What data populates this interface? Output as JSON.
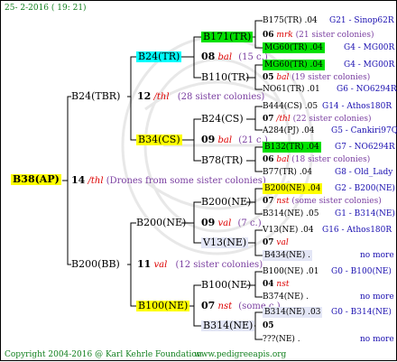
{
  "header": {
    "date": "25- 2-2016 ( 19: 21)"
  },
  "footer": {
    "copyright": "Copyright 2004-2016 @ Karl Kehrle Foundation.",
    "site": "www.pedigreeapis.org"
  },
  "colors": {
    "cyan": "#00ffff",
    "yellow": "#ffff00",
    "green": "#00e000",
    "gray": "#e3e6f6",
    "lines": "#000000"
  },
  "root": {
    "label": "B38(AP)",
    "num": "14",
    "sym": "/thl",
    "desc": "(Drones from some sister colonies)"
  },
  "gen1": [
    {
      "label": "B24(TBR)",
      "num": "12",
      "sym": "/thl",
      "desc": "(28 sister colonies)"
    },
    {
      "label": "B200(BB)",
      "num": "11",
      "sym": "val",
      "desc": "(12 sister colonies)"
    }
  ],
  "gen2": [
    {
      "label": "B24(TR)",
      "num": "08",
      "sym": "bal",
      "desc": "(15 c.)"
    },
    {
      "label": "B34(CS)",
      "num": "09",
      "sym": "bal",
      "desc": "(21 c.)"
    },
    {
      "label": "B200(NE)",
      "num": "09",
      "sym": "val",
      "desc": "(7 c.)"
    },
    {
      "label": "B100(NE)",
      "num": "07",
      "sym": "nst",
      "desc": "(some c.)"
    }
  ],
  "gen3": [
    "B171(TR)",
    "B110(TR)",
    "B24(CS)",
    "B78(TR)",
    "B200(NE)",
    "V13(NE)",
    "B100(NE)",
    "B314(NE)"
  ],
  "gen4": [
    {
      "rows": [
        {
          "text": "B175(TR) .04",
          "ref": "G21 - Sinop62R"
        },
        {
          "num": "06",
          "sym": "mrk",
          "desc": "(21 sister colonies)"
        },
        {
          "text": "MG60(TR) .04",
          "ref": "G4 - MG00R"
        }
      ]
    },
    {
      "rows": [
        {
          "text": "MG60(TR) .04",
          "ref": "G4 - MG00R"
        },
        {
          "num": "05",
          "sym": "bal",
          "desc": "(19 sister colonies)"
        },
        {
          "text": "NO61(TR) .01",
          "ref": "G6 - NO6294R"
        }
      ]
    },
    {
      "rows": [
        {
          "text": "B444(CS) .05",
          "ref": "G14 - Athos180R"
        },
        {
          "num": "07",
          "sym": "/thl",
          "desc": "(22 sister colonies)"
        },
        {
          "text": "A284(PJ) .04",
          "ref": "G5 - Cankiri97Q"
        }
      ]
    },
    {
      "rows": [
        {
          "text": "B132(TR) .04",
          "ref": "G7 - NO6294R"
        },
        {
          "num": "06",
          "sym": "bal",
          "desc": "(18 sister colonies)"
        },
        {
          "text": "B77(TR) .04",
          "ref": "G8 - Old_Lady"
        }
      ]
    },
    {
      "rows": [
        {
          "text": "B200(NE) .04",
          "ref": "G2 - B200(NE)"
        },
        {
          "num": "07",
          "sym": "nst",
          "desc": "(some sister colonies)"
        },
        {
          "text": "B314(NE) .05",
          "ref": "G1 - B314(NE)"
        }
      ]
    },
    {
      "rows": [
        {
          "text": "V13(NE) .04",
          "ref": "G16 - Athos180R"
        },
        {
          "num": "07",
          "sym": "val",
          "desc": ""
        },
        {
          "text": "B434(NE) .",
          "ref": "no more"
        }
      ]
    },
    {
      "rows": [
        {
          "text": "B100(NE) .01",
          "ref": "G0 - B100(NE)"
        },
        {
          "num": "04",
          "sym": "nst",
          "desc": ""
        },
        {
          "text": "B374(NE) .",
          "ref": "no more"
        }
      ]
    },
    {
      "rows": [
        {
          "text": "B314(NE) .03",
          "ref": "G0 - B314(NE)"
        },
        {
          "num": "05",
          "sym": "",
          "desc": ""
        },
        {
          "text": "???(NE) .",
          "ref": "no more"
        }
      ]
    }
  ]
}
